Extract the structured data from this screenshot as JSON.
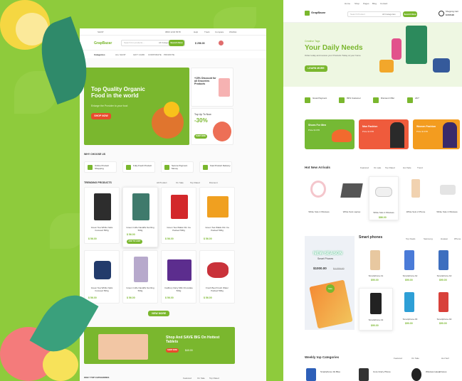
{
  "left_site": {
    "topbar": {
      "shop": "SHOP",
      "phone": "0800 1234 5678",
      "links": [
        "Help",
        "Track",
        "Compare",
        "Wishlist"
      ]
    },
    "logo": "GrapBazar",
    "search": {
      "placeholder": "Search for products...",
      "category": "All Category",
      "button": "Search Now"
    },
    "cart_price": "$ 256.00",
    "nav": {
      "categories": "Categories",
      "items": [
        "ALL SHOP",
        "GIFT CARD",
        "CORPORATE",
        "PROMOTE"
      ]
    },
    "hero": {
      "title": "Top Quality Organic Food in the world",
      "subtitle": "Enlarge the Provider to your food",
      "button": "SHOP NOW"
    },
    "side_promo": {
      "title": "+15% Discount for all Groceries Products",
      "tag": "Top Up To Now",
      "percent": "-30%",
      "button": "SHOP NOW"
    },
    "why_choose": {
      "title": "WHY CHOOSE US",
      "items": [
        "Online Product Shopping",
        "Fully Fresh Product",
        "Secure Payment Money",
        "Fast Product Delivery"
      ]
    },
    "trending": {
      "title": "TRENDING PRODUCTS",
      "tabs": [
        "All Product",
        "On Sale",
        "Top Rated",
        "Discount"
      ],
      "products": [
        {
          "name": "Green Tea Whitlo Nelis Focused 500g",
          "price": "$ 56.00",
          "old": "$56.00"
        },
        {
          "name": "Green Coffe Nacaffis Nerrling 500g",
          "price": "$ 56.00",
          "old": "$56.00",
          "button": "ADD TO CART"
        },
        {
          "name": "Green Tea Wakle Flin Ca Packed 500g",
          "price": "$ 56.00",
          "old": "$56.00"
        },
        {
          "name": "Green Tea Wakle Flin Ca Packed 500g",
          "price": "$ 56.00",
          "old": "$56.00"
        },
        {
          "name": "Green Tea Whitlo Nelis Focused 500g",
          "price": "$ 56.00",
          "old": "$56.00"
        },
        {
          "name": "Green Coffe Nacaffis Nerrling 500g",
          "price": "$ 56.00",
          "old": "$56.00"
        },
        {
          "name": "Cadbury Dairy Milk Chocolate 500g",
          "price": "$ 56.00",
          "old": "$56.00"
        },
        {
          "name": "Fresh Beef Fresh Water Packed 500g",
          "price": "$ 56.00",
          "old": "$56.00"
        }
      ],
      "view_more": "VIEW MORE"
    },
    "banner": {
      "title": "Shop And SAVE BIG On Hottest Tablets",
      "button": "SHOP NOW",
      "price": "$40.00"
    },
    "bottom_title": "ONLY TOP CATEGORIES",
    "bottom_tabs": [
      "Featured",
      "On Sale",
      "Top Rated"
    ]
  },
  "right_site": {
    "logo": "GrapBazar",
    "nav_links": [
      "Home",
      "Shop",
      "Pages",
      "Blog",
      "Contact"
    ],
    "search": {
      "placeholder": "Search Product",
      "category": "All Categories",
      "button": "Search Now"
    },
    "cart": {
      "label": "Shopping Cart",
      "price": "$ 845.98"
    },
    "hero": {
      "eyebrow": "Creative Tags",
      "title": "Your Daily Needs",
      "text": "Order today and receive your Products Today at your home",
      "button": "LEARN MORE"
    },
    "features": [
      "Great Payment",
      "99% Customer",
      "Discount Offer",
      "24/7"
    ],
    "promos": [
      {
        "title": "Shoes For Men",
        "price": "Price $ 0.55",
        "color": "#75b934"
      },
      {
        "title": "Man Fashion",
        "price": "Price $ 0.55",
        "color": "#ef5b3c"
      },
      {
        "title": "Women Fashion",
        "price": "Price $ 0.55",
        "color": "#f39c1f"
      }
    ],
    "new_arrivals": {
      "title": "Hot New Arrivals",
      "tabs": [
        "Featured",
        "On sale",
        "Top Rated",
        "Hot Sale",
        "Trend"
      ],
      "products": [
        {
          "name": "White Solo 2 Wireless",
          "price": ""
        },
        {
          "name": "White Solo Laptop",
          "price": ""
        },
        {
          "name": "White Solo 2 Wireless",
          "price": "$86.00"
        },
        {
          "name": "White Solo 2 Phone",
          "price": ""
        },
        {
          "name": "White Solo 2 Wireless",
          "price": ""
        }
      ]
    },
    "smartphones": {
      "title": "Smart phones",
      "tabs": [
        "Top Deals",
        "Samsung",
        "Huawei",
        "iPhone"
      ],
      "promo": {
        "title": "NEW SEASON",
        "subtitle": "Smart Phones",
        "price": "$1000.00",
        "old": "$ 1200.00",
        "badge": "Sale"
      },
      "products": [
        {
          "name": "Smartphone A1",
          "price": "$90.00"
        },
        {
          "name": "Smartphone A2",
          "price": "$90.00"
        },
        {
          "name": "Smartphone A3",
          "price": "$90.00"
        },
        {
          "name": "Smartphone A4",
          "price": "$90.00"
        },
        {
          "name": "Smartphone A5",
          "price": "$90.00"
        },
        {
          "name": "Smartphone A6",
          "price": "$90.00"
        }
      ]
    },
    "weekly": {
      "title": "Weekly top Categories",
      "tabs": [
        "Featured",
        "On Sale",
        "Hot Sell"
      ],
      "items": [
        "Smartphone 4G Blue",
        "Core Crazy Phone",
        "Wireless Headphones"
      ]
    }
  }
}
